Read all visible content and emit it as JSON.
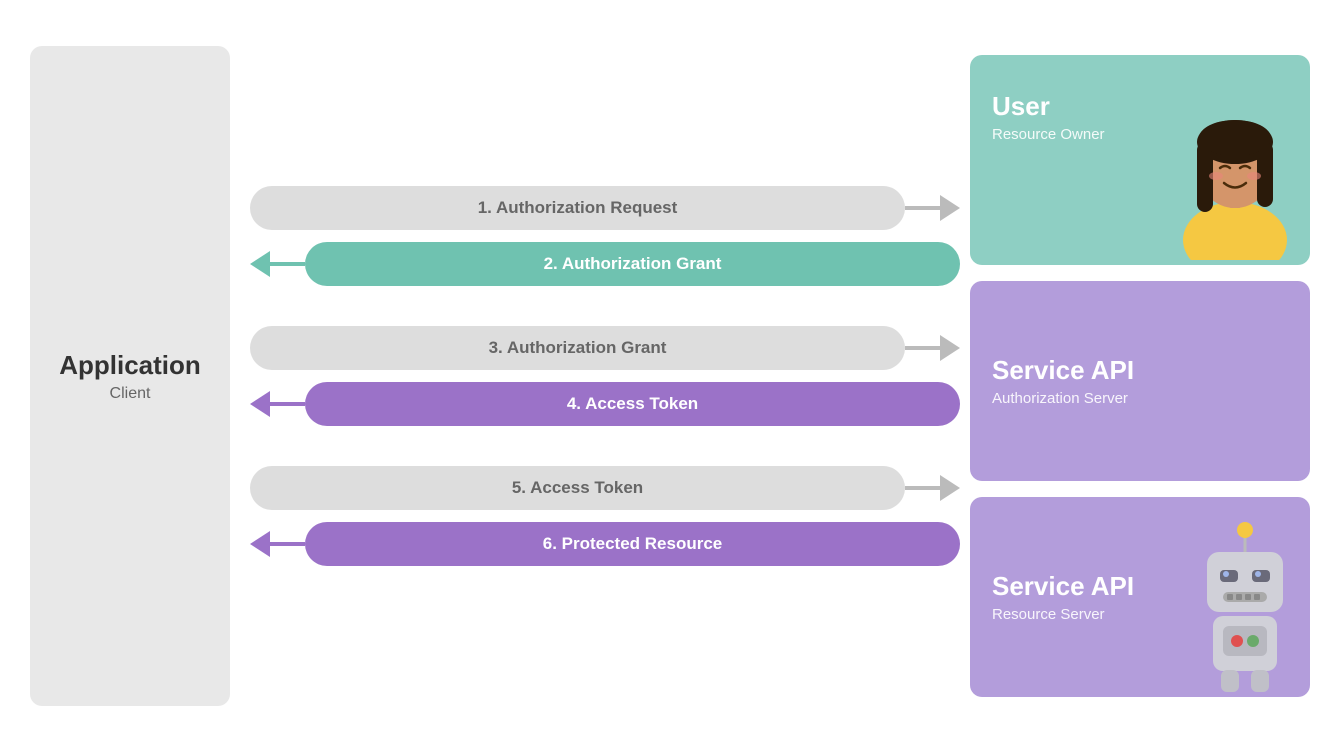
{
  "client": {
    "title": "Application",
    "subtitle": "Client"
  },
  "arrows": {
    "step1": {
      "label": "1. Authorization Request",
      "direction": "right",
      "style": "gray"
    },
    "step2": {
      "label": "2. Authorization Grant",
      "direction": "left",
      "style": "teal"
    },
    "step3": {
      "label": "3. Authorization Grant",
      "direction": "right",
      "style": "gray"
    },
    "step4": {
      "label": "4. Access Token",
      "direction": "left",
      "style": "purple"
    },
    "step5": {
      "label": "5. Access Token",
      "direction": "right",
      "style": "gray"
    },
    "step6": {
      "label": "6. Protected Resource",
      "direction": "left",
      "style": "purple"
    }
  },
  "panels": {
    "user": {
      "title": "User",
      "subtitle": "Resource Owner",
      "style": "teal"
    },
    "authServer": {
      "title": "Service API",
      "subtitle": "Authorization Server",
      "style": "purple"
    },
    "resourceServer": {
      "title": "Service API",
      "subtitle": "Resource Server",
      "style": "purple"
    }
  },
  "colors": {
    "gray_bg": "#e8e8e8",
    "teal": "#6fc2b0",
    "teal_panel": "#8ecfc3",
    "purple": "#9b72c8",
    "purple_panel": "#b39ddb",
    "arrow_gray": "#c8c8c8",
    "pill_gray_bg": "#ddd",
    "pill_gray_text": "#666"
  }
}
